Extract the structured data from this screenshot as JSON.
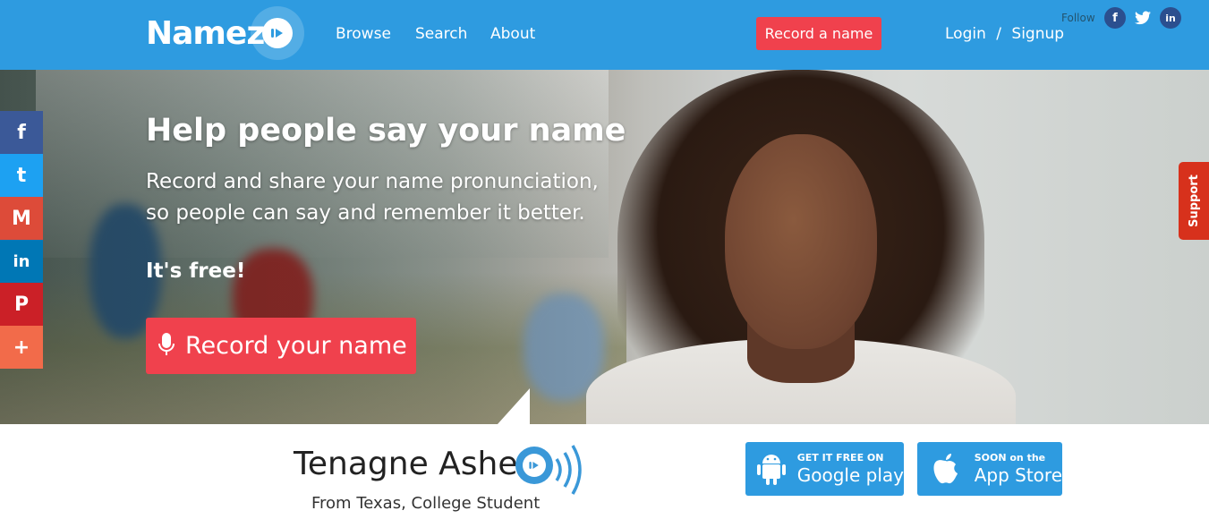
{
  "brand": {
    "name": "Namez"
  },
  "nav": {
    "links": [
      "Browse",
      "Search",
      "About"
    ],
    "record_button": "Record a name",
    "login": "Login",
    "separator": "/",
    "signup": "Signup",
    "follow_label": "Follow",
    "follow_icons": [
      "facebook-icon",
      "twitter-icon",
      "linkedin-icon"
    ]
  },
  "hero": {
    "title": "Help people say your name",
    "subtitle": "Record and share your name pronunciation, so people can say and remember it better.",
    "free": "It's free!",
    "cta": "Record your name"
  },
  "share_bar": {
    "items": [
      {
        "icon": "facebook-icon",
        "glyph": "f",
        "color": "#3b5998"
      },
      {
        "icon": "twitter-icon",
        "glyph": "t",
        "color": "#1da1f2"
      },
      {
        "icon": "gmail-icon",
        "glyph": "M",
        "color": "#dd4b39"
      },
      {
        "icon": "linkedin-icon",
        "glyph": "in",
        "color": "#0077b5"
      },
      {
        "icon": "pinterest-icon",
        "glyph": "P",
        "color": "#cb2027"
      },
      {
        "icon": "more-icon",
        "glyph": "+",
        "color": "#f26b4a"
      }
    ]
  },
  "support": {
    "label": "Support"
  },
  "featured": {
    "name": "Tenagne Ashe",
    "meta": "From Texas, College Student"
  },
  "stores": {
    "google": {
      "small": "GET IT FREE ON",
      "big": "Google play"
    },
    "apple": {
      "small": "SOON on the",
      "big": "App Store"
    }
  },
  "colors": {
    "primary": "#2e9be0",
    "accent": "#f0414d",
    "support": "#d7311c"
  }
}
